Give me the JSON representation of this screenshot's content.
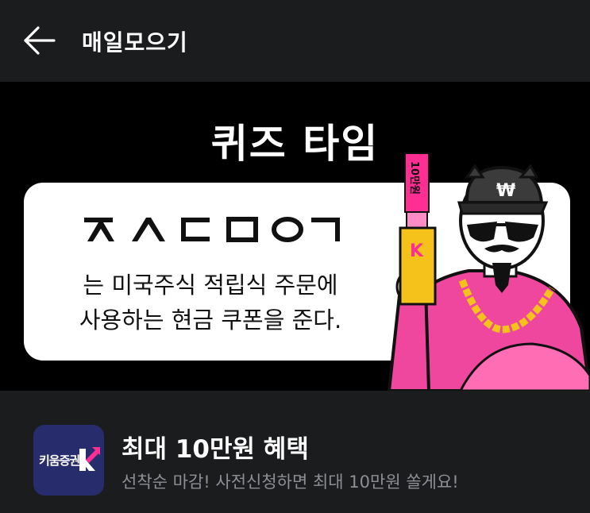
{
  "header": {
    "back_icon": "arrow-left-icon",
    "title": "매일모으기"
  },
  "banner": {
    "title": "퀴즈 타임",
    "consonants": "ㅈㅅㄷㅁㅇㄱ",
    "line1": "는 미국주식 적립식 주문에",
    "line2": "사용하는 현금 쿠폰을 준다.",
    "ticket_text": "10만원",
    "colors": {
      "accent_pink": "#ff2e93",
      "robe_pink": "#f0479e",
      "gold": "#f4c21a"
    }
  },
  "promo": {
    "logo_text": "키움증권",
    "logo_mark_letter": "K",
    "title": "최대 10만원 혜택",
    "subtitle": "선착순 마감! 사전신청하면 최대 10만원 쏠게요!",
    "colors": {
      "logo_bg": "#272d6c"
    }
  }
}
